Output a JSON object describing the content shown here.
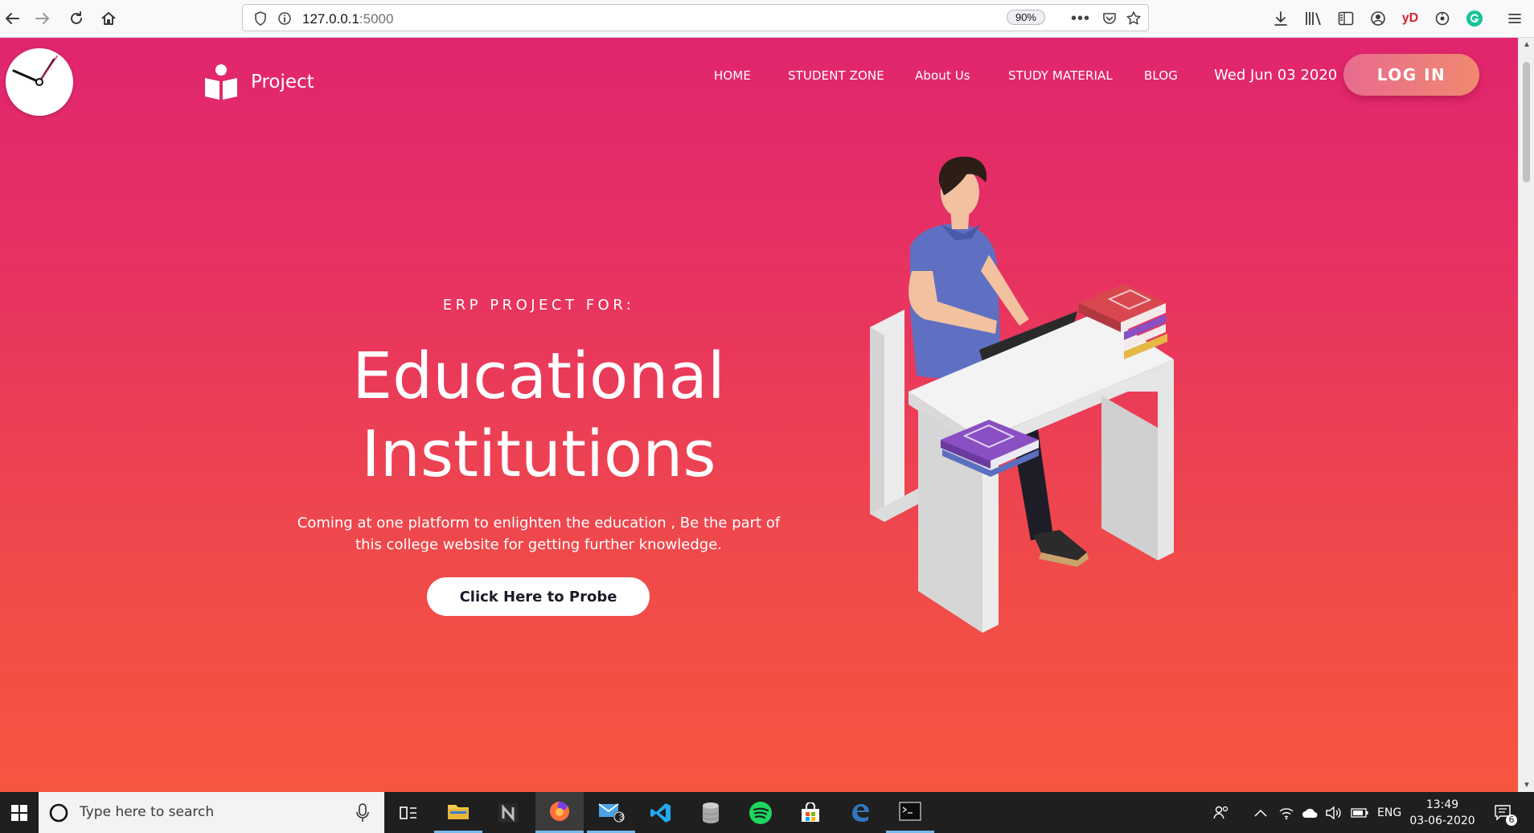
{
  "browser": {
    "url_host": "127.0.0.1",
    "url_port": ":5000",
    "zoom": "90%"
  },
  "site": {
    "brand_name": "Project",
    "nav": {
      "home": "HOME",
      "student_zone": "STUDENT ZONE",
      "about": "About Us",
      "study_material": "STUDY MATERIAL",
      "blog": "BLOG"
    },
    "date": "Wed Jun 03 2020",
    "login_label": "LOG IN",
    "hero": {
      "kicker": "ERP PROJECT FOR:",
      "title_line1": "Educational",
      "title_line2": "Institutions",
      "description": "Coming at one platform to enlighten the education , Be the part of this college website for getting further knowledge.",
      "cta_label": "Click Here to Probe"
    },
    "colors": {
      "gradient_top": "#e1256f",
      "gradient_bottom": "#f65640",
      "login_gradient_start": "#e86b8f",
      "login_gradient_end": "#f0896f"
    }
  },
  "taskbar": {
    "search_placeholder": "Type here to search",
    "mail_badge": "3",
    "language": "ENG",
    "time": "13:49",
    "date": "03-06-2020",
    "notification_count": "6"
  }
}
